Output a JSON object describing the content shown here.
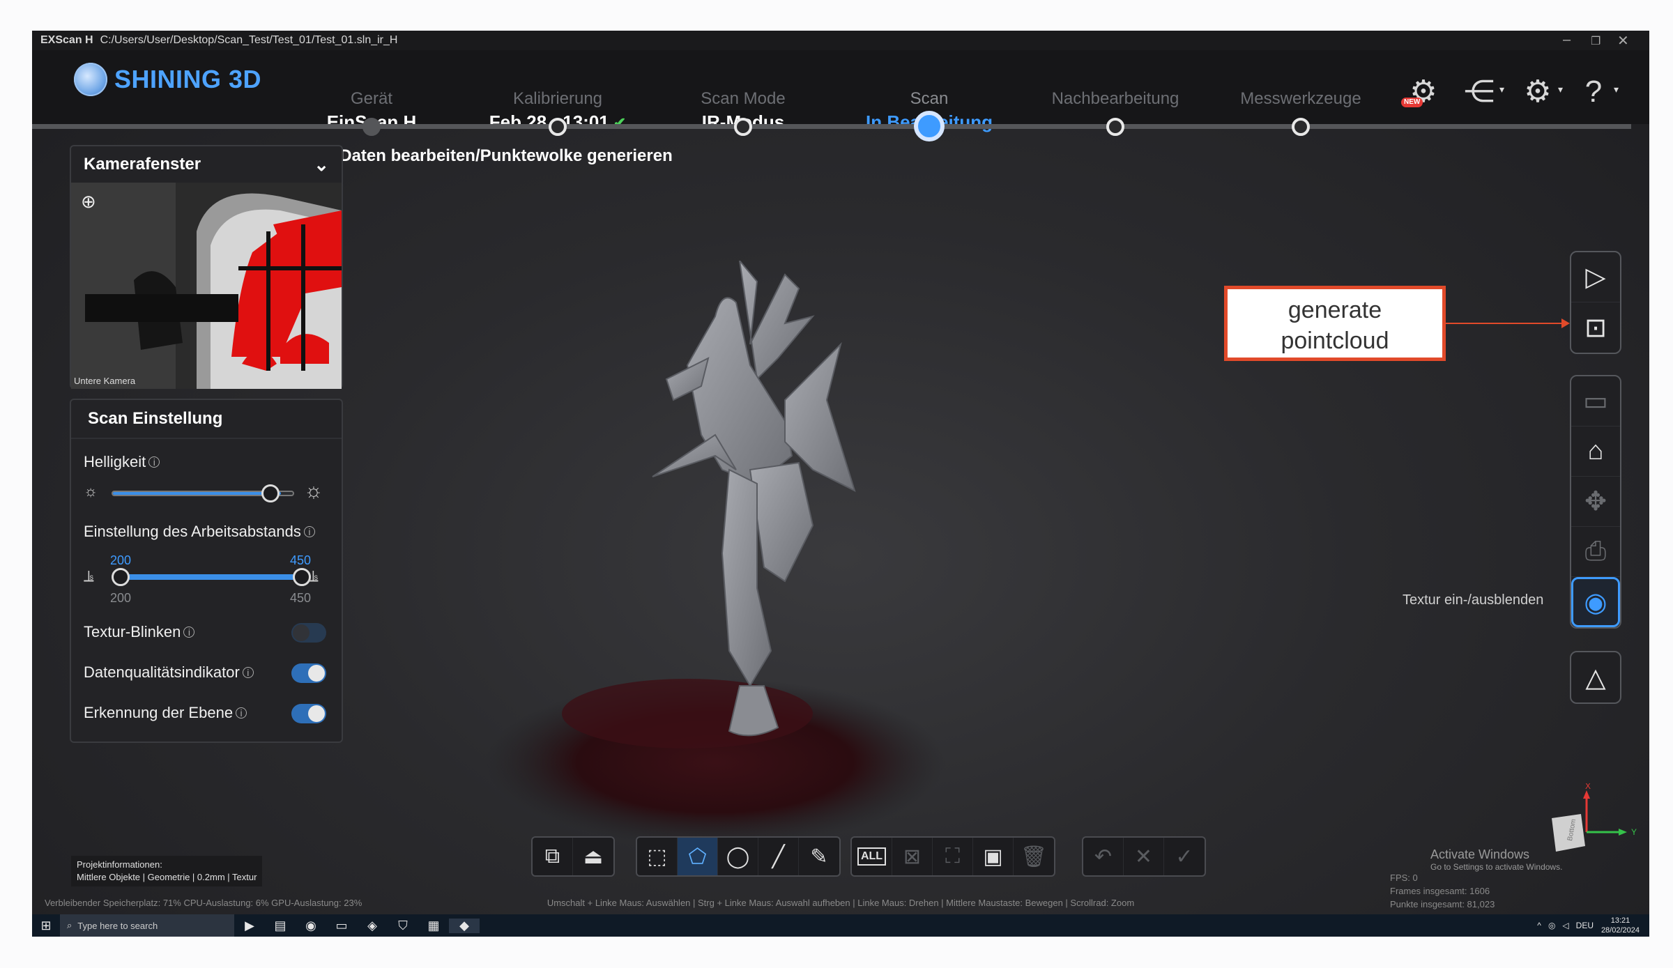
{
  "titlebar": {
    "app": "EXScan H",
    "path": "C:/Users/User/Desktop/Scan_Test/Test_01/Test_01.sln_ir_H"
  },
  "logo": {
    "text": "SHINING 3D"
  },
  "steps": [
    {
      "label": "Gerät",
      "value": "EinScan H"
    },
    {
      "label": "Kalibrierung",
      "value": "Feb.28 - 13:01"
    },
    {
      "label": "Scan Mode",
      "value": "IR-Modus"
    },
    {
      "label": "Scan",
      "value": "In Bearbeitung"
    },
    {
      "label": "Nachbearbeitung",
      "value": "-"
    },
    {
      "label": "Messwerkzeuge",
      "value": "-"
    }
  ],
  "step_hint": "Daten bearbeiten/Punktewolke generieren",
  "header_icons": {
    "new_badge": "NEW",
    "help": "?"
  },
  "camera": {
    "title": "Kamerafenster",
    "label": "Untere Kamera"
  },
  "scan_settings": {
    "title": "Scan Einstellung",
    "brightness_label": "Helligkeit",
    "brightness_level": 0.92,
    "distance_label": "Einstellung des Arbeitsabstands",
    "distance_min_top": "200",
    "distance_max_top": "450",
    "distance_min_bottom": "200",
    "distance_max_bottom": "450",
    "texture_blink_label": "Textur-Blinken",
    "texture_blink_on": false,
    "quality_label": "Datenqualitätsindikator",
    "quality_on": true,
    "plane_label": "Erkennung der Ebene",
    "plane_on": true
  },
  "callout": {
    "line1": "generate",
    "line2": "pointcloud"
  },
  "right_toolbar": {
    "texture_tip": "Textur ein-/ausblenden"
  },
  "bottom_toolbar": {
    "all_label": "ALL"
  },
  "project_info": {
    "title": "Projektinformationen:",
    "details": "Mittlere Objekte | Geometrie | 0.2mm | Textur"
  },
  "status": {
    "system": "Verbleibender Speicherplatz: 71%  CPU-Auslastung: 6%  GPU-Auslastung: 23%",
    "hint": "Umschalt + Linke Maus: Auswählen | Strg + Linke Maus: Auswahl aufheben | Linke Maus: Drehen | Mittlere Maustaste: Bewegen | Scrollrad: Zoom",
    "fps": "FPS: 0",
    "frames": "Frames insgesamt: 1606",
    "points": "Punkte insgesamt: 81,023"
  },
  "activate_windows": {
    "title": "Activate Windows",
    "sub": "Go to Settings to activate Windows."
  },
  "axes": {
    "x": "X",
    "y": "Y",
    "cube": "Bottom"
  },
  "taskbar": {
    "search_placeholder": "Type here to search",
    "lang": "DEU",
    "time": "13:21",
    "date": "28/02/2024"
  },
  "colors": {
    "accent": "#3e9bff",
    "callout": "#e14a2a",
    "check": "#4cd25a"
  }
}
